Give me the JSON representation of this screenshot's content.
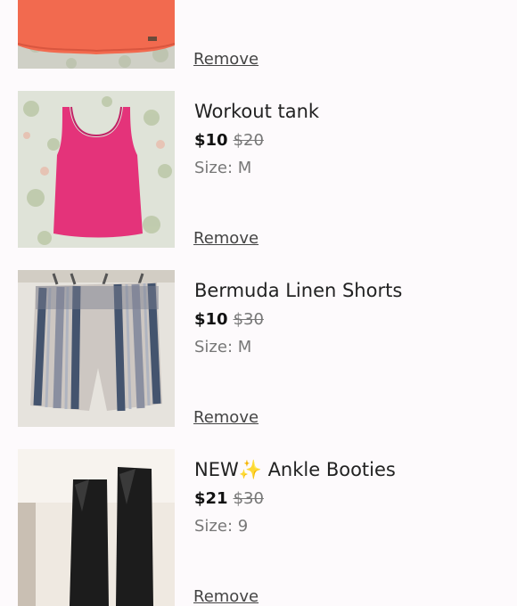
{
  "items": [
    {
      "title": "",
      "price": "",
      "original_price": "",
      "size": "",
      "remove_label": "Remove",
      "color": "#f26a4f"
    },
    {
      "title": "Workout tank",
      "price": "$10",
      "original_price": "$20",
      "size": "Size: M",
      "remove_label": "Remove",
      "color": "#e4337a"
    },
    {
      "title": "Bermuda Linen Shorts",
      "price": "$10",
      "original_price": "$30",
      "size": "Size: M",
      "remove_label": "Remove",
      "color": "#44546e"
    },
    {
      "title": "NEW✨ Ankle Booties",
      "price": "$21",
      "original_price": "$30",
      "size": "Size: 9",
      "remove_label": "Remove",
      "color": "#1c1c1c"
    }
  ]
}
